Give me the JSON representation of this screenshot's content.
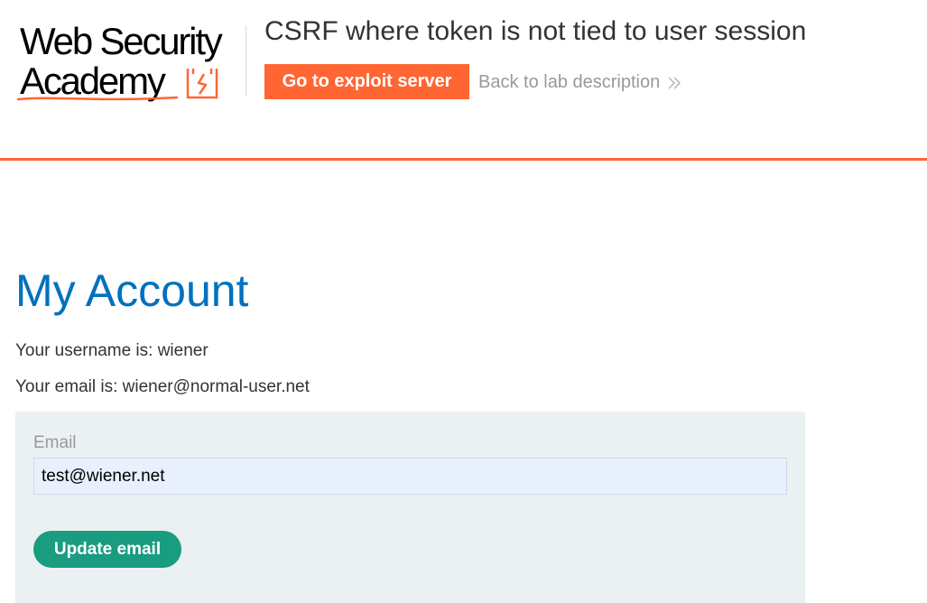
{
  "header": {
    "logo": {
      "line1": "Web Security",
      "line2": "Academy",
      "accent_color": "#ff6633"
    },
    "lab_title": "CSRF where token is not tied to user session",
    "exploit_button_label": "Go to exploit server",
    "back_link_label": "Back to lab description",
    "back_link_icon": "double-chevron-right-icon",
    "divider_color": "#ff6633"
  },
  "main": {
    "title": "My Account",
    "username_line": "Your username is: wiener",
    "email_line": "Your email is: wiener@normal-user.net",
    "form": {
      "email_label": "Email",
      "email_value": "test@wiener.net",
      "submit_label": "Update email",
      "submit_color": "#1a9c80",
      "panel_color": "#ebf0f2"
    },
    "title_color": "#0071bc"
  }
}
